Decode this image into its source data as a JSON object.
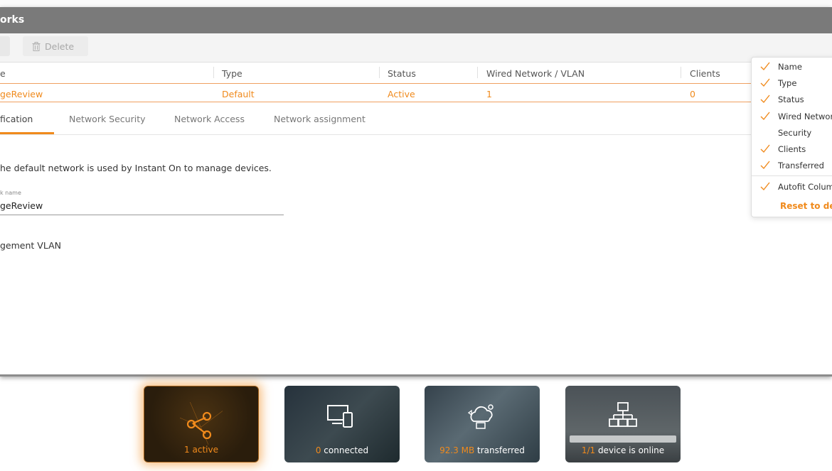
{
  "window": {
    "title": "orks"
  },
  "toolbar": {
    "delete_label": "Delete"
  },
  "table": {
    "columns": [
      "e",
      "Type",
      "Status",
      "Wired Network / VLAN",
      "Clients"
    ],
    "row": {
      "name": "geReview",
      "type": "Default",
      "status": "Active",
      "vlan": "1",
      "clients": "0"
    }
  },
  "tabs": [
    "fication",
    "Network Security",
    "Network Access",
    "Network assignment"
  ],
  "details": {
    "description": "he default network is used by Instant On to manage devices.",
    "network_name_label": "k name",
    "network_name_value": "geReview",
    "vlan_label": "gement VLAN"
  },
  "column_menu": {
    "items": [
      {
        "label": "Name",
        "checked": true
      },
      {
        "label": "Type",
        "checked": true
      },
      {
        "label": "Status",
        "checked": true
      },
      {
        "label": "Wired Network",
        "checked": true
      },
      {
        "label": "Security",
        "checked": false
      },
      {
        "label": "Clients",
        "checked": true
      },
      {
        "label": "Transferred",
        "checked": true
      }
    ],
    "autofit_label": "Autofit Columns",
    "reset_label": "Reset to default"
  },
  "tiles": [
    {
      "num": "1",
      "text": " active"
    },
    {
      "num": "0",
      "text": " connected"
    },
    {
      "num": "92.3 MB",
      "text": " transferred"
    },
    {
      "num": "1/1",
      "text": " device is online"
    }
  ],
  "colors": {
    "accent": "#f08a1c",
    "titlebar": "#7a7a7a"
  }
}
